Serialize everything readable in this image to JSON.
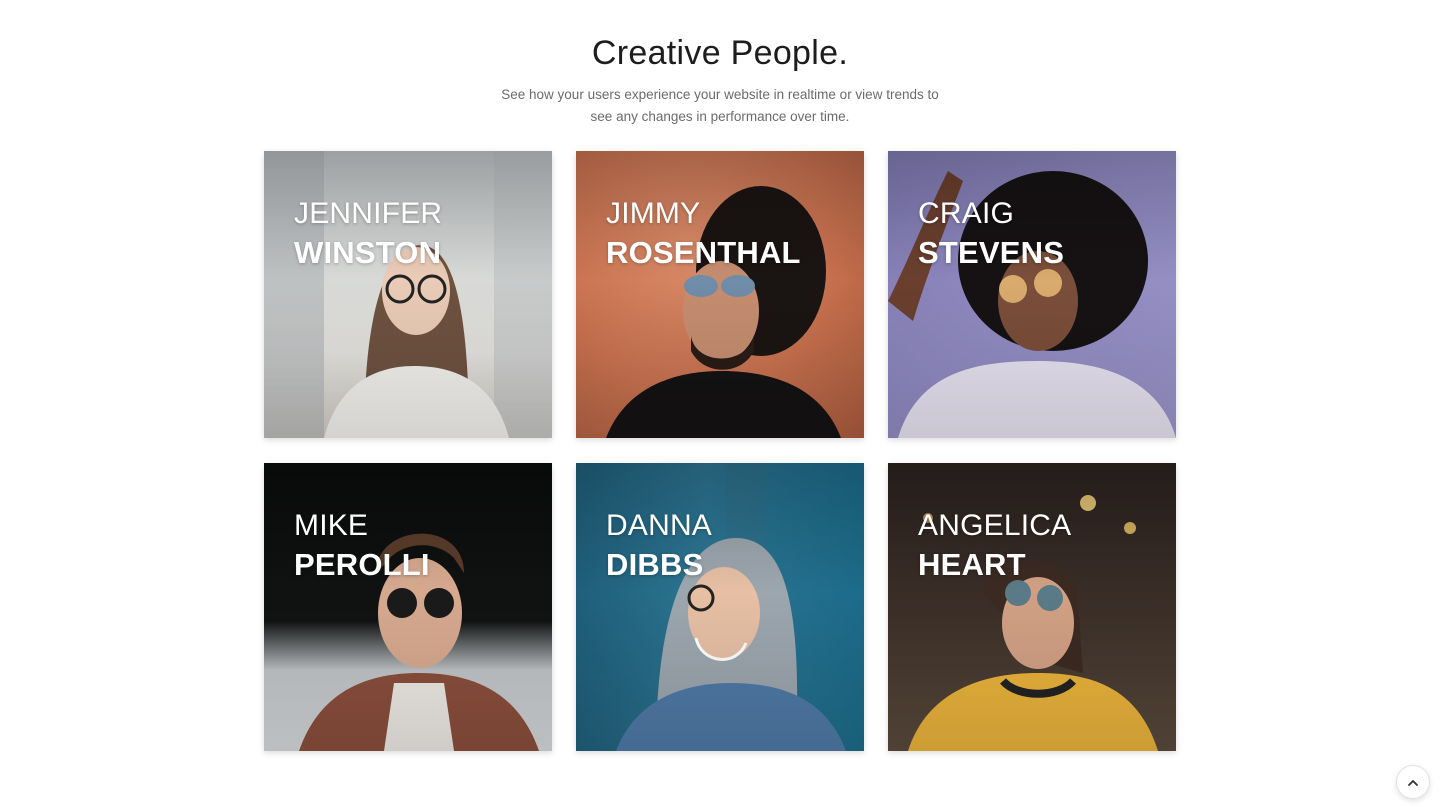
{
  "header": {
    "title": "Creative People.",
    "subtitle_line1": "See how your users experience your website in realtime or view trends to",
    "subtitle_line2": "see any changes in performance over time."
  },
  "people": [
    {
      "first": "JENNIFER",
      "last": "WINSTON"
    },
    {
      "first": "JIMMY",
      "last": "ROSENTHAL"
    },
    {
      "first": "CRAIG",
      "last": "STEVENS"
    },
    {
      "first": "MIKE",
      "last": "PEROLLI"
    },
    {
      "first": "DANNA",
      "last": "DIBBS"
    },
    {
      "first": "ANGELICA",
      "last": "HEART"
    }
  ],
  "scroll_top": {
    "icon": "chevron-up-icon"
  }
}
